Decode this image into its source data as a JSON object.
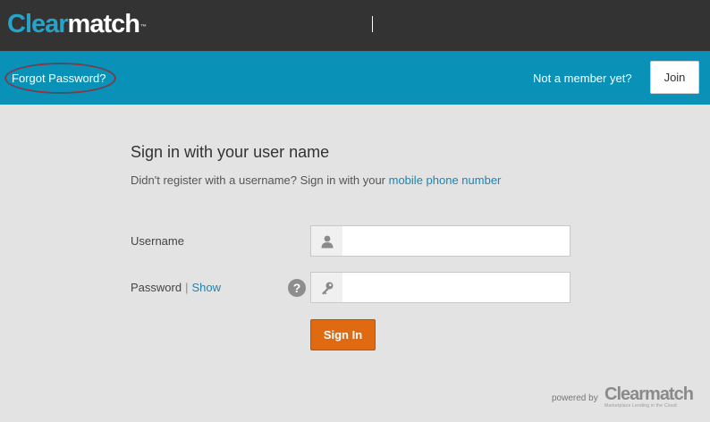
{
  "header": {
    "logo_part1": "Clear",
    "logo_part2": "match",
    "logo_tm": "™"
  },
  "bluebar": {
    "forgot_password": "Forgot Password?",
    "not_member": "Not a member yet?",
    "join_label": "Join"
  },
  "form": {
    "title": "Sign in with your user name",
    "subtitle_prefix": "Didn't register with a username? Sign in with your ",
    "subtitle_link": "mobile phone number",
    "username_label": "Username",
    "username_value": "",
    "password_label": "Password",
    "separator": "|",
    "show_label": "Show",
    "password_value": "",
    "help_glyph": "?",
    "signin_label": "Sign In"
  },
  "footer": {
    "powered_by": "powered by",
    "logo": "Clearmatch",
    "tagline": "Marketplace Lending in the Cloud"
  },
  "icons": {
    "user": "user-icon",
    "key": "key-icon",
    "help": "help-icon"
  },
  "colors": {
    "topbar": "#333333",
    "bluebar": "#0991b7",
    "accent_orange": "#e06a12",
    "logo_blue": "#26a3c9",
    "link_blue": "#1a86b3"
  }
}
